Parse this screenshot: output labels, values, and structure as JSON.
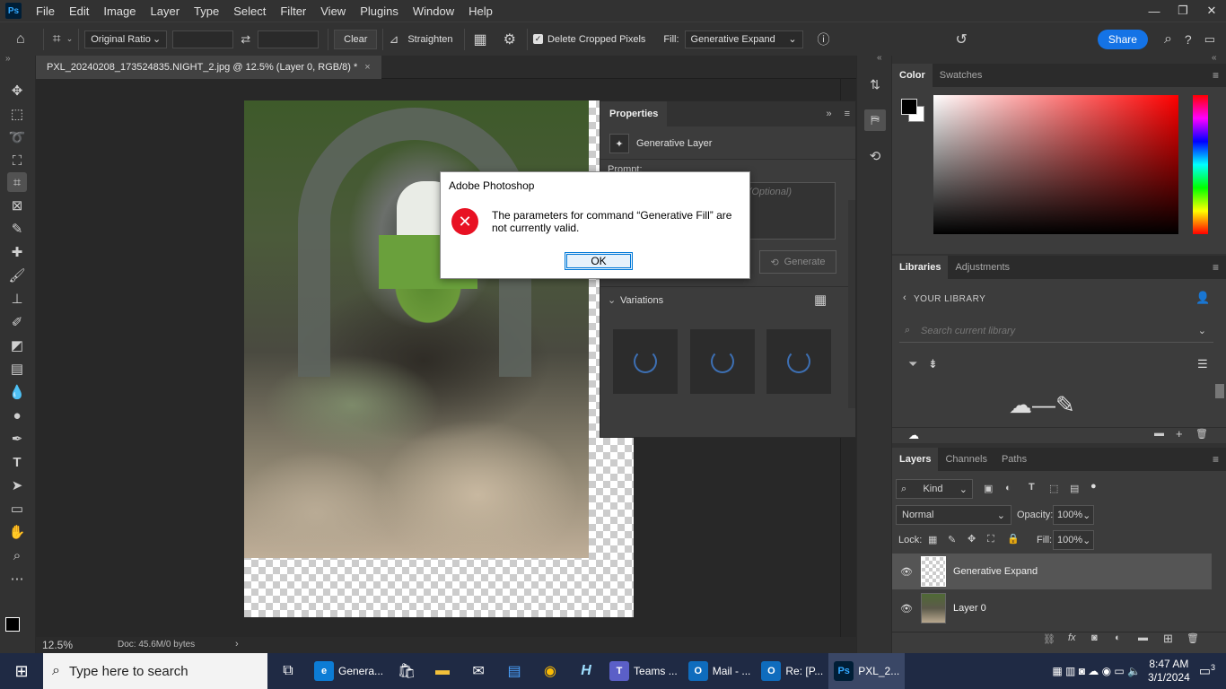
{
  "menubar": {
    "logo": "Ps",
    "items": [
      "File",
      "Edit",
      "Image",
      "Layer",
      "Type",
      "Select",
      "Filter",
      "View",
      "Plugins",
      "Window",
      "Help"
    ]
  },
  "options": {
    "ratio": "Original Ratio",
    "clear": "Clear",
    "straighten": "Straighten",
    "delete_cropped": "Delete Cropped Pixels",
    "fill_label": "Fill:",
    "fill_value": "Generative Expand",
    "share": "Share"
  },
  "document": {
    "tab_title": "PXL_20240208_173524835.NIGHT_2.jpg @ 12.5% (Layer 0, RGB/8) *",
    "zoom": "12.5%",
    "doc_info": "Doc: 45.6M/0 bytes"
  },
  "properties": {
    "title": "Properties",
    "layer_type": "Generative Layer",
    "prompt_label": "Prompt:",
    "prompt_placeholder": "(Optional)",
    "generate": "Generate",
    "variations": "Variations"
  },
  "dialog": {
    "title": "Adobe Photoshop",
    "message": "The parameters for command “Generative Fill” are not currently valid.",
    "ok": "OK"
  },
  "color_panel": {
    "tabs": [
      "Color",
      "Swatches"
    ]
  },
  "libraries_panel": {
    "tabs": [
      "Libraries",
      "Adjustments"
    ],
    "your_library": "YOUR LIBRARY",
    "search_placeholder": "Search current library"
  },
  "layers_panel": {
    "tabs": [
      "Layers",
      "Channels",
      "Paths"
    ],
    "kind": "Kind",
    "blend_mode": "Normal",
    "opacity_label": "Opacity:",
    "opacity": "100%",
    "lock_label": "Lock:",
    "fill_label": "Fill:",
    "fill": "100%",
    "layers": [
      {
        "name": "Generative Expand"
      },
      {
        "name": "Layer 0"
      }
    ]
  },
  "taskbar": {
    "search_placeholder": "Type here to search",
    "apps": [
      {
        "label": "Genera...",
        "color": "#0c7cd5"
      },
      {
        "label": "Teams ...",
        "color": "#5b5fc7"
      },
      {
        "label": "Mail - ...",
        "color": "#0f6cbd"
      },
      {
        "label": "Re: [P...",
        "color": "#0f6cbd"
      },
      {
        "label": "PXL_2...",
        "color": "#001e36"
      }
    ],
    "time": "8:47 AM",
    "date": "3/1/2024",
    "notifications": "3"
  }
}
